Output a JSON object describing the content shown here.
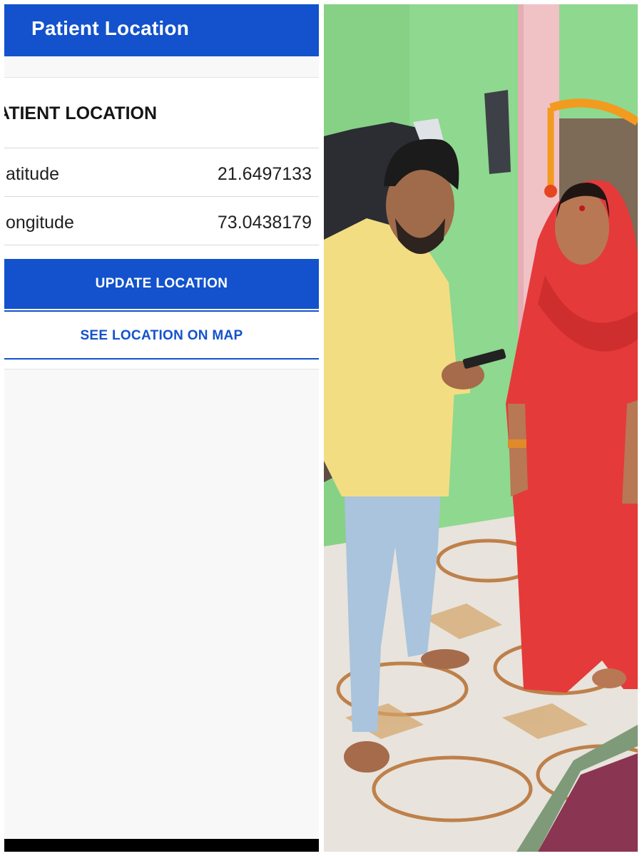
{
  "app_bar": {
    "title": "Patient Location"
  },
  "card": {
    "header": "ATIENT LOCATION",
    "rows": [
      {
        "label": ".atitude",
        "value": "21.6497133"
      },
      {
        "label": ".ongitude",
        "value": "73.0438179"
      }
    ]
  },
  "buttons": {
    "update": "UPDATE LOCATION",
    "map": "SEE LOCATION ON MAP"
  },
  "colors": {
    "primary": "#1352cc",
    "wall": "#8ed88f",
    "saree": "#e53a3a",
    "shirt": "#f3dd83",
    "jeans": "#a9c4dc"
  }
}
